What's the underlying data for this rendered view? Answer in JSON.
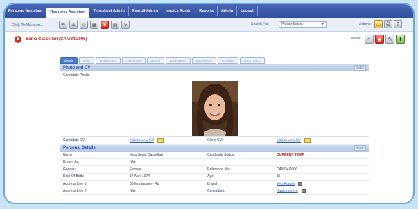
{
  "nav": {
    "tabs": [
      {
        "label": "Personal Assistant"
      },
      {
        "label": "Resource Assistant"
      },
      {
        "label": "Timesheet Admin"
      },
      {
        "label": "Payroll Admin"
      },
      {
        "label": "Invoice Admin"
      },
      {
        "label": "Reports"
      },
      {
        "label": "Admin"
      },
      {
        "label": "Logout"
      }
    ],
    "active": "Resource Assistant"
  },
  "toolbar": {
    "manage_label": "Click To Manage...",
    "search_label": "Search For:",
    "search_value": "Please Select",
    "actions_label": "Actions:"
  },
  "record": {
    "title": "Sonia Cassellari (CAN/34/2006)",
    "mode_label": "Mode:"
  },
  "subtabs": [
    "details",
    "skills",
    "employment",
    "references",
    "payroll",
    "applications",
    "placements",
    "schedule",
    "quick match"
  ],
  "photo_section": {
    "title": "Photo and CV",
    "hide_label": "[hide]",
    "photo_label": "Candidate Photo:",
    "candidate_cv_label": "Candidate CV:",
    "candidate_cv_link": "click to view CV",
    "client_cv_label": "Client CV:",
    "client_cv_link": "click to view CV"
  },
  "personal_section": {
    "title": "Personal Details",
    "hide_label": "[hide]",
    "rows": [
      {
        "label": "Name:",
        "value": "Miss Sonia Cassellari",
        "label2": "Candidate Status:",
        "value2": "CURRENT TEMP"
      },
      {
        "label": "Known As:",
        "value": "N/A",
        "label2": "",
        "value2": ""
      },
      {
        "label": "Gender:",
        "value": "Female",
        "label2": "Reference No.:",
        "value2": "CAN/34/2006"
      },
      {
        "label": "Date Of Birth:",
        "value": "17 April 1974",
        "label2": "Age:",
        "value2": "35"
      },
      {
        "label": "Address Line 1:",
        "value": "36 Montgomery Rd",
        "label2": "Branch:",
        "value2": "Test Branch"
      },
      {
        "label": "Address Line 2:",
        "value": "N/A",
        "label2": "Consultant:",
        "value2": "IBAAdmin Ltd"
      }
    ]
  },
  "colors": {
    "nav_bg": "#2f4f9e",
    "accent_red": "#c0281f",
    "link": "#2a5bc0",
    "frame_border": "#6aaad8"
  }
}
